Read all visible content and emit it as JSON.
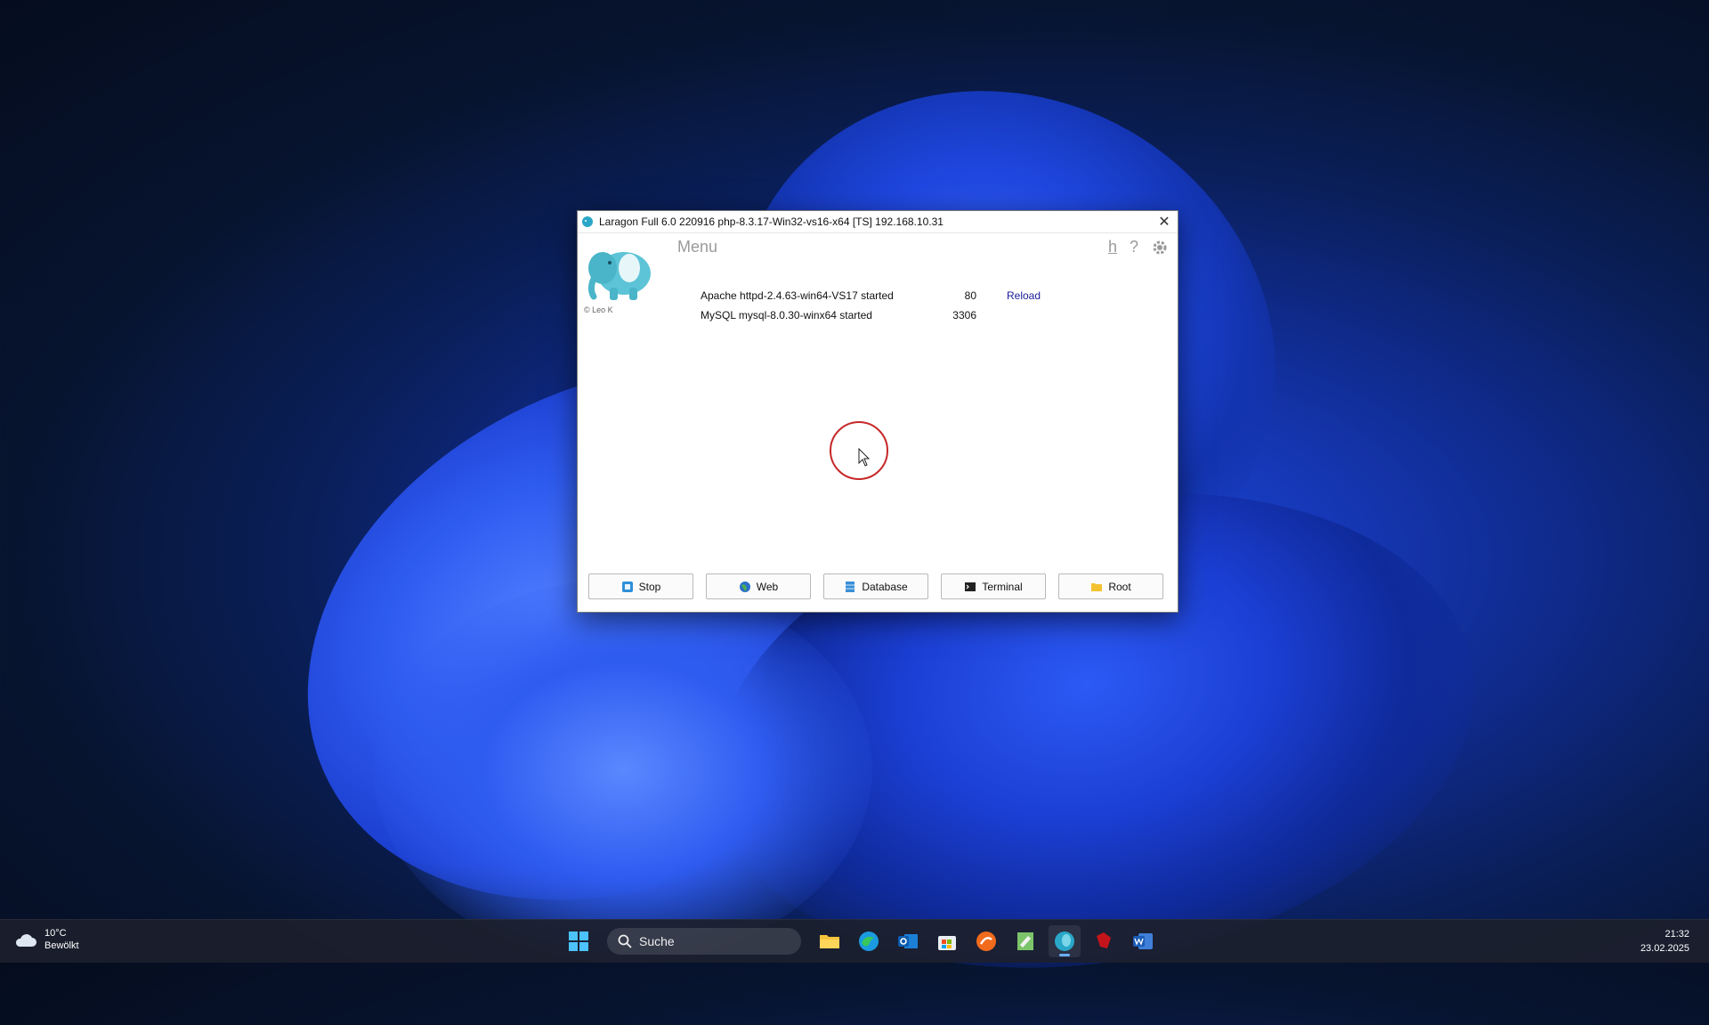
{
  "window": {
    "title": "Laragon Full 6.0 220916 php-8.3.17-Win32-vs16-x64 [TS]  192.168.10.31",
    "close_symbol": "✕",
    "menu_label": "Menu",
    "copyright": "© Leo K",
    "top_icons": {
      "h": "h",
      "help": "?",
      "settings_icon": "gear-icon"
    },
    "services": [
      {
        "name": "Apache httpd-2.4.63-win64-VS17 started",
        "port": "80",
        "action": "Reload"
      },
      {
        "name": "MySQL mysql-8.0.30-winx64 started",
        "port": "3306",
        "action": ""
      }
    ],
    "buttons": {
      "stop": "Stop",
      "web": "Web",
      "database": "Database",
      "terminal": "Terminal",
      "root": "Root"
    }
  },
  "taskbar": {
    "weather": {
      "temp": "10°C",
      "condition": "Bewölkt"
    },
    "search_label": "Suche",
    "clock": {
      "time": "21:32",
      "date": "23.02.2025"
    },
    "apps": [
      "start-icon",
      "file-explorer-icon",
      "edge-icon",
      "outlook-icon",
      "store-icon",
      "app-orange-icon",
      "notepad-icon",
      "laragon-icon",
      "app-red-icon",
      "word-icon"
    ]
  },
  "colors": {
    "accent": "#1a1a9a",
    "cursor_ring": "#c62828"
  }
}
